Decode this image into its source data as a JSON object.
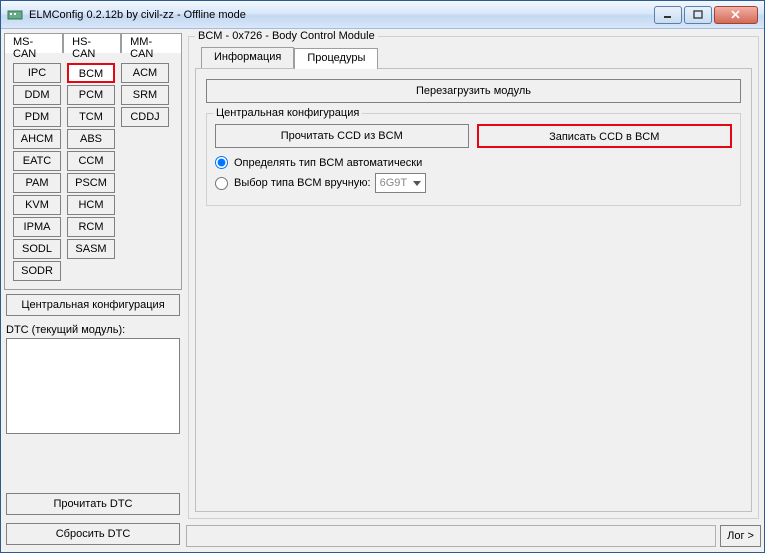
{
  "window": {
    "title": "ELMConfig 0.2.12b by civil-zz - Offline mode"
  },
  "bus_tabs": [
    "MS-CAN",
    "HS-CAN",
    "MM-CAN"
  ],
  "modules": {
    "col1": [
      "IPC",
      "DDM",
      "PDM",
      "AHCM",
      "EATC",
      "PAM",
      "KVM",
      "IPMA",
      "SODL",
      "SODR"
    ],
    "col2": [
      "BCM",
      "PCM",
      "TCM",
      "ABS",
      "CCM",
      "PSCM",
      "HCM",
      "RCM",
      "SASM"
    ],
    "col3": [
      "ACM",
      "SRM",
      "CDDJ"
    ]
  },
  "left": {
    "central_config_btn": "Центральная конфигурация",
    "dtc_group": "DTC (текущий модуль):",
    "read_dtc": "Прочитать DTC",
    "reset_dtc": "Сбросить DTC"
  },
  "right": {
    "header": "BCM - 0x726 - Body Control Module",
    "tabs": {
      "info": "Информация",
      "proc": "Процедуры"
    },
    "reload": "Перезагрузить модуль",
    "ccd_group": "Центральная конфигурация",
    "read_ccd": "Прочитать CCD из BCM",
    "write_ccd": "Записать CCD в BCM",
    "radio_auto": "Определять тип BCM автоматически",
    "radio_manual": "Выбор типа BCM вручную:",
    "manual_value": "6G9T",
    "log_btn": "Лог >"
  }
}
